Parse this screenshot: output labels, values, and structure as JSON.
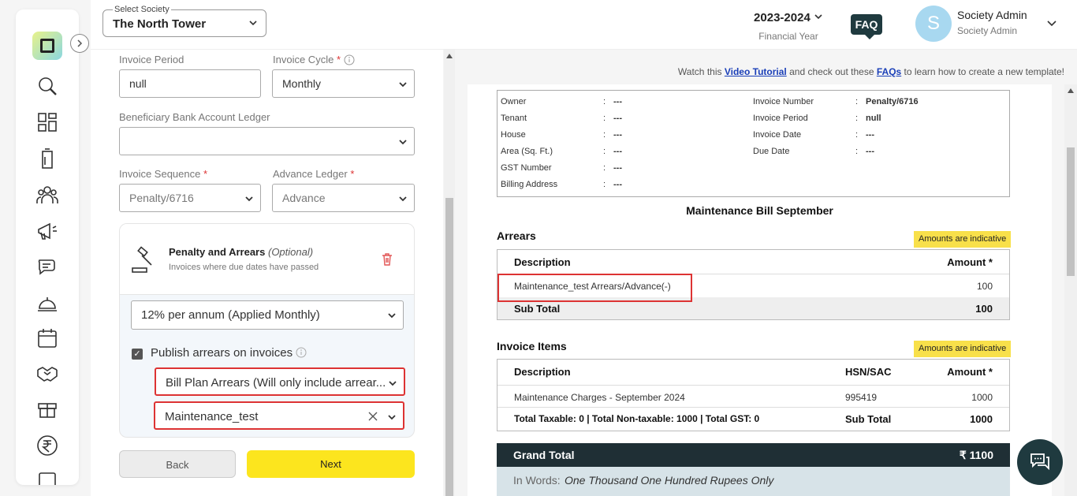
{
  "header": {
    "society_label": "Select Society",
    "society_value": "The North Tower",
    "financial_year": "2023-2024",
    "financial_year_label": "Financial Year",
    "faq": "FAQ",
    "avatar_letter": "S",
    "admin_name": "Society Admin",
    "admin_role": "Society Admin"
  },
  "form": {
    "invoice_period_label": "Invoice Period",
    "invoice_period_value": "null",
    "invoice_cycle_label": "Invoice Cycle",
    "invoice_cycle_value": "Monthly",
    "beneficiary_label": "Beneficiary Bank Account Ledger",
    "beneficiary_value": "",
    "invoice_sequence_label": "Invoice Sequence",
    "invoice_sequence_value": "Penalty/6716",
    "advance_ledger_label": "Advance Ledger",
    "advance_ledger_value": "Advance",
    "required_mark": "*",
    "penalty": {
      "title": "Penalty and Arrears",
      "optional": "(Optional)",
      "subtitle": "Invoices where due dates have passed",
      "rate_value": "12% per annum (Applied Monthly)",
      "publish_label": "Publish arrears on invoices",
      "arrears_type_value": "Bill Plan Arrears (Will only include arrear...",
      "bill_plan_value": "Maintenance_test"
    },
    "back_label": "Back",
    "next_label": "Next"
  },
  "preview": {
    "tutorial_pre": "Watch this",
    "tutorial_link": "Video Tutorial",
    "tutorial_mid": "and check out these",
    "faq_link": "FAQs",
    "tutorial_post": "to learn how to create a new template!",
    "info_left": [
      {
        "label": "Owner",
        "value": "---"
      },
      {
        "label": "Tenant",
        "value": "---"
      },
      {
        "label": "House",
        "value": "---"
      },
      {
        "label": "Area (Sq. Ft.)",
        "value": "---"
      },
      {
        "label": "GST Number",
        "value": "---"
      },
      {
        "label": "Billing Address",
        "value": "---"
      }
    ],
    "info_right": [
      {
        "label": "Invoice Number",
        "value": "Penalty/6716"
      },
      {
        "label": "Invoice Period",
        "value": "null"
      },
      {
        "label": "Invoice Date",
        "value": "---"
      },
      {
        "label": "Due Date",
        "value": "---"
      }
    ],
    "colon": ":",
    "bill_title": "Maintenance Bill September",
    "arrears": {
      "title": "Arrears",
      "tag": "Amounts are indicative",
      "col_description": "Description",
      "col_amount": "Amount *",
      "row_description": "Maintenance_test Arrears/Advance(-)",
      "row_amount": "100",
      "subtotal_label": "Sub Total",
      "subtotal_value": "100"
    },
    "items": {
      "title": "Invoice Items",
      "tag": "Amounts are indicative",
      "col_description": "Description",
      "col_hsn": "HSN/SAC",
      "col_amount": "Amount *",
      "row_description": "Maintenance Charges - September 2024",
      "row_hsn": "995419",
      "row_amount": "1000",
      "totals_text": "Total Taxable: 0 | Total Non-taxable: 1000 | Total GST: 0",
      "subtotal_label": "Sub Total",
      "subtotal_value": "1000"
    },
    "grand_total_label": "Grand Total",
    "grand_total_value": "₹ 1100",
    "words_label": "In Words:",
    "words_value": "One Thousand One Hundred Rupees Only"
  },
  "colors": {
    "accent_yellow": "#fce51e",
    "dark_teal": "#1f3a3f",
    "highlight_red": "#d33333"
  }
}
